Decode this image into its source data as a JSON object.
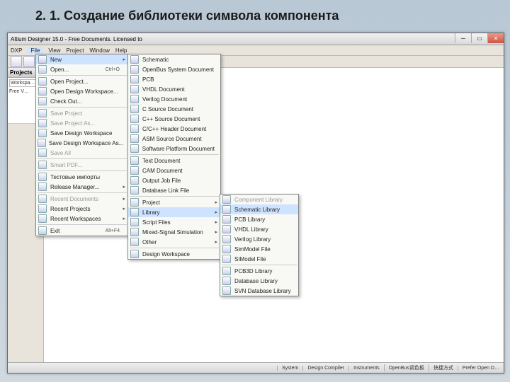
{
  "slide": {
    "title": "2. 1. Создание библиотеки символа компонента"
  },
  "window": {
    "title": "Altium Designer 15.0 - Free Documents. Licensed to"
  },
  "menubar": [
    "DXP",
    "File",
    "View",
    "Project",
    "Window",
    "Help"
  ],
  "sidebar": {
    "header": "Projects",
    "workspace": "Workspa…",
    "item": "Free V…"
  },
  "statusbar": [
    "System",
    "Design Compiler",
    "Instruments",
    "OpenBus调色板",
    "快捷方式",
    "Prefer Open D…"
  ],
  "file_menu": {
    "items": [
      {
        "label": "New",
        "sc": "",
        "arrow": true,
        "highlight": true
      },
      {
        "label": "Open...",
        "sc": "Ctrl+O"
      },
      {
        "sep": true
      },
      {
        "label": "Open Project..."
      },
      {
        "label": "Open Design Workspace..."
      },
      {
        "label": "Check Out..."
      },
      {
        "sep": true
      },
      {
        "label": "Save Project",
        "disabled": true
      },
      {
        "label": "Save Project As...",
        "disabled": true
      },
      {
        "label": "Save Design Workspace"
      },
      {
        "label": "Save Design Workspace As..."
      },
      {
        "label": "Save All",
        "disabled": true
      },
      {
        "sep": true
      },
      {
        "label": "Smart PDF...",
        "disabled": true
      },
      {
        "sep": true
      },
      {
        "label": "Тестовые импорты"
      },
      {
        "label": "Release Manager...",
        "arrow": true
      },
      {
        "sep": true
      },
      {
        "label": "Recent Documents",
        "arrow": true,
        "disabled": true
      },
      {
        "label": "Recent Projects",
        "arrow": true
      },
      {
        "label": "Recent Workspaces",
        "arrow": true
      },
      {
        "sep": true
      },
      {
        "label": "Exit",
        "sc": "Alt+F4"
      }
    ]
  },
  "new_menu": {
    "items": [
      {
        "label": "Schematic"
      },
      {
        "label": "OpenBus System Document"
      },
      {
        "label": "PCB"
      },
      {
        "label": "VHDL Document"
      },
      {
        "label": "Verilog Document"
      },
      {
        "label": "C Source Document"
      },
      {
        "label": "C++ Source Document"
      },
      {
        "label": "C/C++ Header Document"
      },
      {
        "label": "ASM Source Document"
      },
      {
        "label": "Software Platform Document"
      },
      {
        "sep": true
      },
      {
        "label": "Text Document"
      },
      {
        "label": "CAM Document"
      },
      {
        "label": "Output Job File"
      },
      {
        "label": "Database Link File"
      },
      {
        "sep": true
      },
      {
        "label": "Project",
        "arrow": true
      },
      {
        "label": "Library",
        "arrow": true,
        "highlight": true
      },
      {
        "label": "Script Files",
        "arrow": true
      },
      {
        "label": "Mixed-Signal Simulation",
        "arrow": true
      },
      {
        "label": "Other",
        "arrow": true
      },
      {
        "sep": true
      },
      {
        "label": "Design Workspace"
      }
    ]
  },
  "lib_menu": {
    "items": [
      {
        "label": "Component Library",
        "disabled": true
      },
      {
        "label": "Schematic Library",
        "highlight": true
      },
      {
        "label": "PCB Library"
      },
      {
        "label": "VHDL Library"
      },
      {
        "label": "Verilog Library"
      },
      {
        "label": "SimModel File"
      },
      {
        "label": "SIModel File"
      },
      {
        "sep": true
      },
      {
        "label": "PCB3D Library"
      },
      {
        "label": "Database Library"
      },
      {
        "label": "SVN Database Library"
      }
    ]
  }
}
